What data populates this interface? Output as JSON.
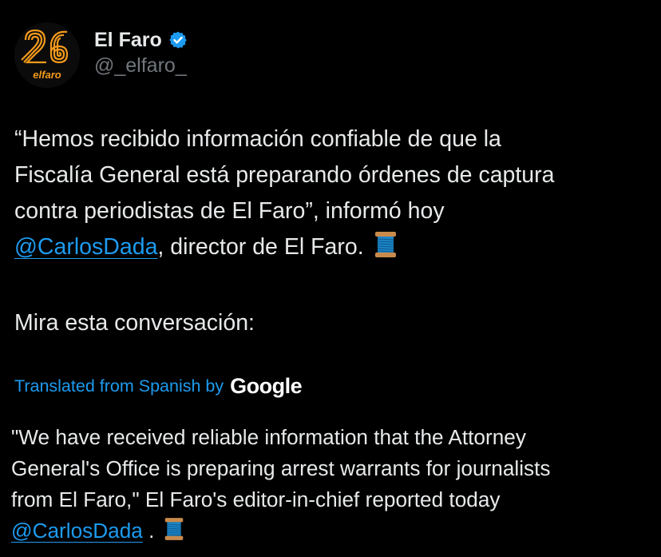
{
  "author": {
    "display_name": "El Faro",
    "handle": "@_elfaro_",
    "avatar_number": "26",
    "avatar_wordmark": "elfaro",
    "verified": true
  },
  "tweet": {
    "line1": "“Hemos recibido información confiable de que la",
    "line2": "Fiscalía General está preparando órdenes de captura",
    "line3": "contra periodistas de El Faro”, informó hoy",
    "mention": "@CarlosDada",
    "line4_rest": ", director de El Faro.",
    "line5": "Mira esta conversación:"
  },
  "translation_label": {
    "prefix": "Translated from Spanish by",
    "provider": "Google"
  },
  "translation": {
    "line1": "\"We have received reliable information that the Attorney",
    "line2": "General's Office is preparing arrest warrants for journalists",
    "line3": "from El Faro,\" El Faro's editor-in-chief reported today",
    "mention": "@CarlosDada",
    "line4_rest": " ."
  },
  "icons": {
    "verified": "verified-badge-icon",
    "thread": "spool-of-thread-icon"
  },
  "colors": {
    "background": "#000000",
    "text": "#e7e9ea",
    "secondary": "#71767b",
    "link": "#1d9bf0",
    "avatar_orange": "#f39a1c"
  }
}
